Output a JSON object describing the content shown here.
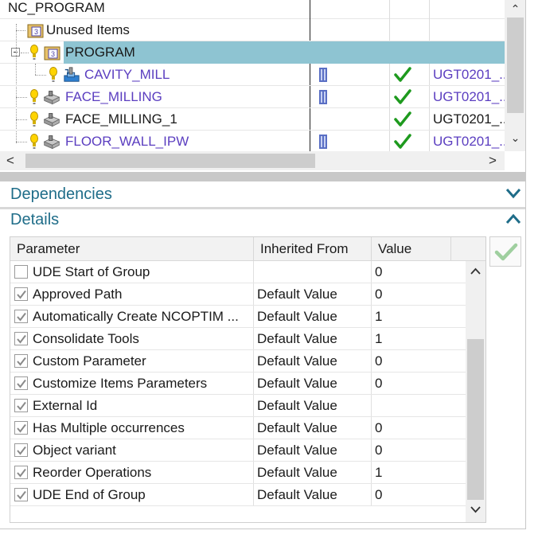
{
  "tree": {
    "header": "NC_PROGRAM",
    "rows": [
      {
        "name": "Unused Items",
        "col2": "",
        "col3": "",
        "col4": ""
      },
      {
        "name": "PROGRAM",
        "col2": "",
        "col3": "",
        "col4": ""
      },
      {
        "name": "CAVITY_MILL",
        "col2": "",
        "col3": "",
        "col4": "UGT0201_.."
      },
      {
        "name": "FACE_MILLING",
        "col2": "",
        "col3": "",
        "col4": "UGT0201_.."
      },
      {
        "name": "FACE_MILLING_1",
        "col2": "",
        "col3": "",
        "col4": "UGT0201_.."
      },
      {
        "name": "FLOOR_WALL_IPW",
        "col2": "",
        "col3": "",
        "col4": "UGT0201_.."
      }
    ]
  },
  "scroll": {
    "up": "⌃",
    "down": "⌄",
    "left": "<",
    "right": ">"
  },
  "sections": {
    "dependencies": "Dependencies",
    "details": "Details"
  },
  "details": {
    "headers": [
      "Parameter",
      "Inherited From",
      "Value"
    ],
    "rows": [
      {
        "param": "UDE Start of Group",
        "inherited": "",
        "value": "0",
        "checked": false
      },
      {
        "param": "Approved Path",
        "inherited": "Default Value",
        "value": "0",
        "checked": true
      },
      {
        "param": "Automatically Create NCOPTIM ...",
        "inherited": "Default Value",
        "value": "1",
        "checked": true
      },
      {
        "param": "Consolidate Tools",
        "inherited": "Default Value",
        "value": "1",
        "checked": true
      },
      {
        "param": "Custom Parameter",
        "inherited": "Default Value",
        "value": "0",
        "checked": true
      },
      {
        "param": "Customize Items Parameters",
        "inherited": "Default Value",
        "value": "0",
        "checked": true
      },
      {
        "param": "External Id",
        "inherited": "Default Value",
        "value": "",
        "checked": true
      },
      {
        "param": "Has Multiple occurrences",
        "inherited": "Default Value",
        "value": "0",
        "checked": true
      },
      {
        "param": "Object variant",
        "inherited": "Default Value",
        "value": "0",
        "checked": true
      },
      {
        "param": "Reorder Operations",
        "inherited": "Default Value",
        "value": "1",
        "checked": true
      },
      {
        "param": "UDE End of Group",
        "inherited": "Default Value",
        "value": "0",
        "checked": true
      }
    ]
  },
  "colors": {
    "selection": "#8ec4d2",
    "link_purple": "#5b3ec0",
    "section_blue": "#1f6d89",
    "check_green": "#1e9a1e"
  }
}
